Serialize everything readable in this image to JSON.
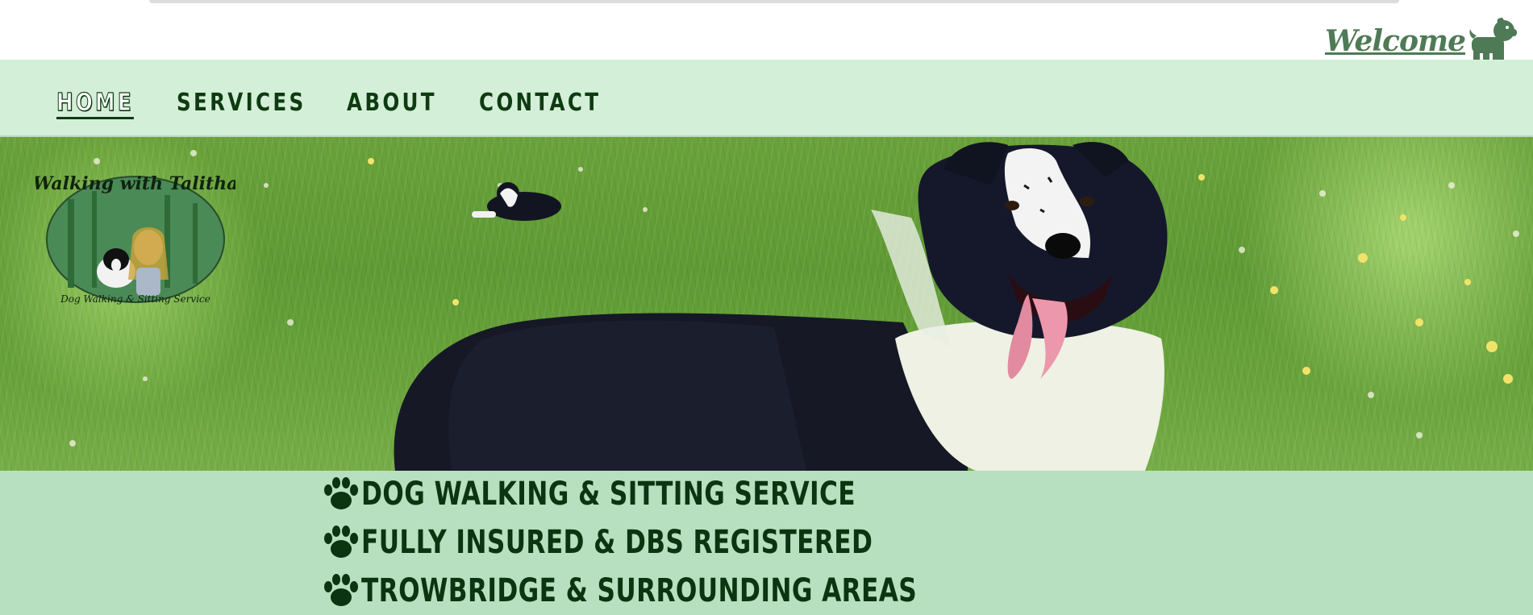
{
  "header": {
    "welcome_label": "Welcome",
    "welcome_icon": "dog-icon",
    "accent_color": "#4f7a56"
  },
  "nav": {
    "items": [
      {
        "label": "HOME",
        "active": true
      },
      {
        "label": "SERVICES",
        "active": false
      },
      {
        "label": "ABOUT",
        "active": false
      },
      {
        "label": "CONTACT",
        "active": false
      }
    ],
    "background": "#d4efd8",
    "text_color": "#0e3b12"
  },
  "hero": {
    "logo": {
      "title": "Walking with Talitha",
      "subtitle": "Dog Walking & Sitting Service"
    },
    "image": "border-collie-on-grass"
  },
  "features": {
    "background": "#b7e0c0",
    "icon": "paw-icon",
    "items": [
      "DOG WALKING & SITTING SERVICE",
      "FULLY INSURED & DBS REGISTERED",
      "TROWBRIDGE & SURROUNDING AREAS"
    ]
  }
}
